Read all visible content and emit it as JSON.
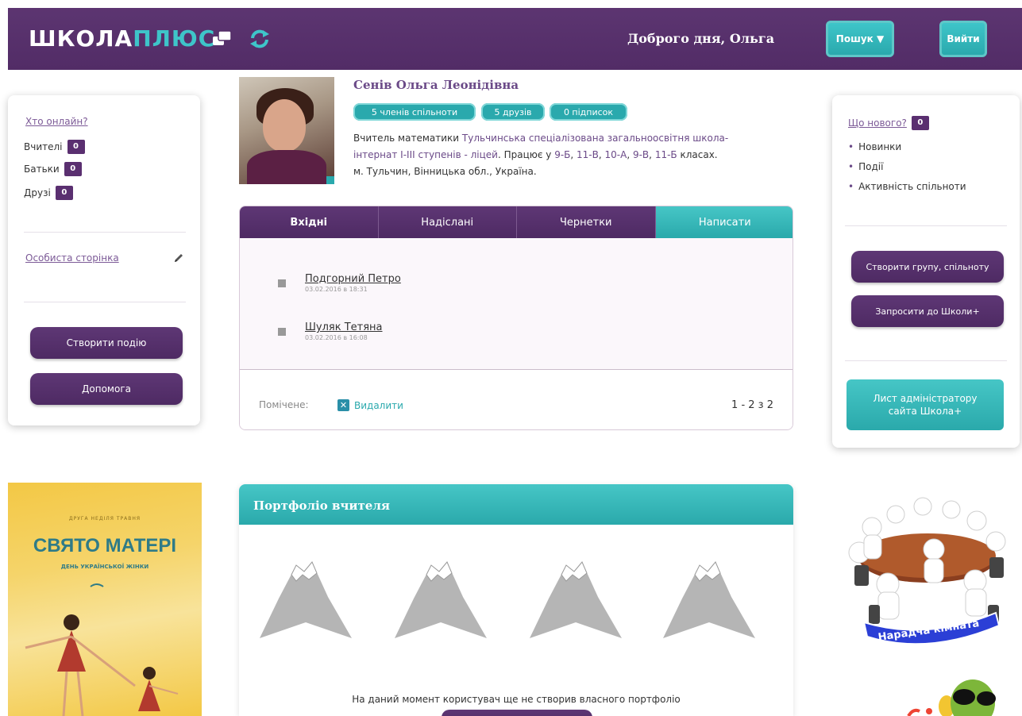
{
  "header": {
    "logo_main": "ШКОЛА",
    "logo_accent": "ПЛЮС",
    "greeting": "Доброго дня, Ольга",
    "search_label": "Пошук ▼",
    "exit_label": "Вийти"
  },
  "left": {
    "online_link": "Хто онлайн?",
    "stats": [
      {
        "label": "Вчителі",
        "count": "0"
      },
      {
        "label": "Батьки",
        "count": "0"
      },
      {
        "label": "Друзі",
        "count": "0"
      }
    ],
    "personal_page": "Особиста сторінка",
    "create_event": "Створити подію",
    "help": "Допомога"
  },
  "profile": {
    "name": "Сенів Ольга Леонідівна",
    "tags": [
      "5 членів спільноти",
      "5 друзів",
      "0 підписок"
    ],
    "bio_prefix": "Вчитель математики ",
    "school_link": "Тульчинська спеціалізована загальноосвітня школа-інтернат І-ІІІ ступенів - ліцей",
    "bio_works": ". Працює у ",
    "classes": [
      "9-Б",
      "11-В",
      "10-А",
      "9-В",
      "11-Б"
    ],
    "bio_classes_suffix": " класах.",
    "location": "м. Тульчин, Вінницька обл., Україна."
  },
  "messages": {
    "tabs": [
      "Вхідні",
      "Надіслані",
      "Чернетки",
      "Написати"
    ],
    "items": [
      {
        "from": "Подгорний Петро",
        "date": "03.02.2016 в 18:31"
      },
      {
        "from": "Шуляк Тетяна",
        "date": "03.02.2016 в 16:08"
      }
    ],
    "marked_label": "Помічене:",
    "delete_label": "Видалити",
    "pager": "1 - 2 з 2"
  },
  "right": {
    "news_link": "Що нового?",
    "news_count": "0",
    "bullets": [
      "Новинки",
      "Події",
      "Активність спільноти"
    ],
    "create_group": "Створити групу, спільноту",
    "invite": "Запросити до Школи+",
    "admin_letter": "Лист адміністратору сайта Школа+"
  },
  "portfolio": {
    "title": "Портфоліо вчителя",
    "empty_text": "На даний момент користувач ще не створив власного портфоліо"
  },
  "ads": {
    "poster_small": "ДРУГА НЕДІЛЯ ТРАВНЯ",
    "poster_title": "СВЯТО МАТЕРІ",
    "poster_sub": "ДЕНЬ УКРАЇНСЬКОЇ ЖІНКИ",
    "meeting_label": "Нарадча кімната"
  },
  "colors": {
    "brand_purple": "#522c66",
    "brand_teal": "#2aa9ad"
  }
}
